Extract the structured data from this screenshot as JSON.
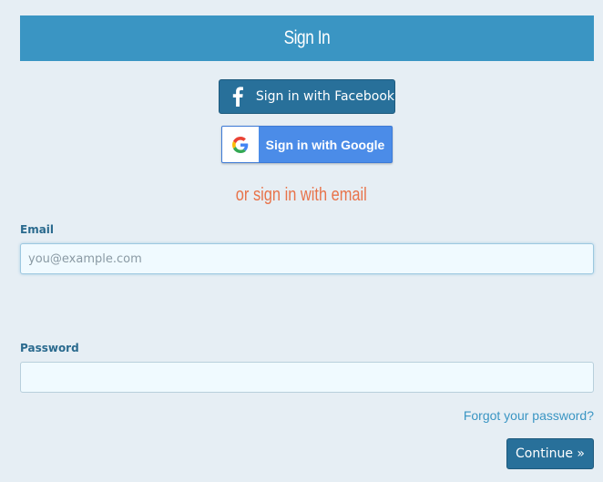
{
  "header": {
    "title": "Sign In",
    "color": "#3a95c3"
  },
  "facebook_button": {
    "label": "Sign in with Facebook",
    "icon": "facebook-icon",
    "color": "#28709a"
  },
  "google_button": {
    "label": "Sign in with Google",
    "icon": "google-icon",
    "color": "#4b8ce8"
  },
  "divider": {
    "text": "or sign in with email",
    "color": "#e8734a"
  },
  "email_field": {
    "label": "Email",
    "placeholder": "you@example.com",
    "value": ""
  },
  "password_field": {
    "label": "Password",
    "value": ""
  },
  "forgot_password": {
    "label": "Forgot your password?"
  },
  "continue_button": {
    "label": "Continue »"
  }
}
